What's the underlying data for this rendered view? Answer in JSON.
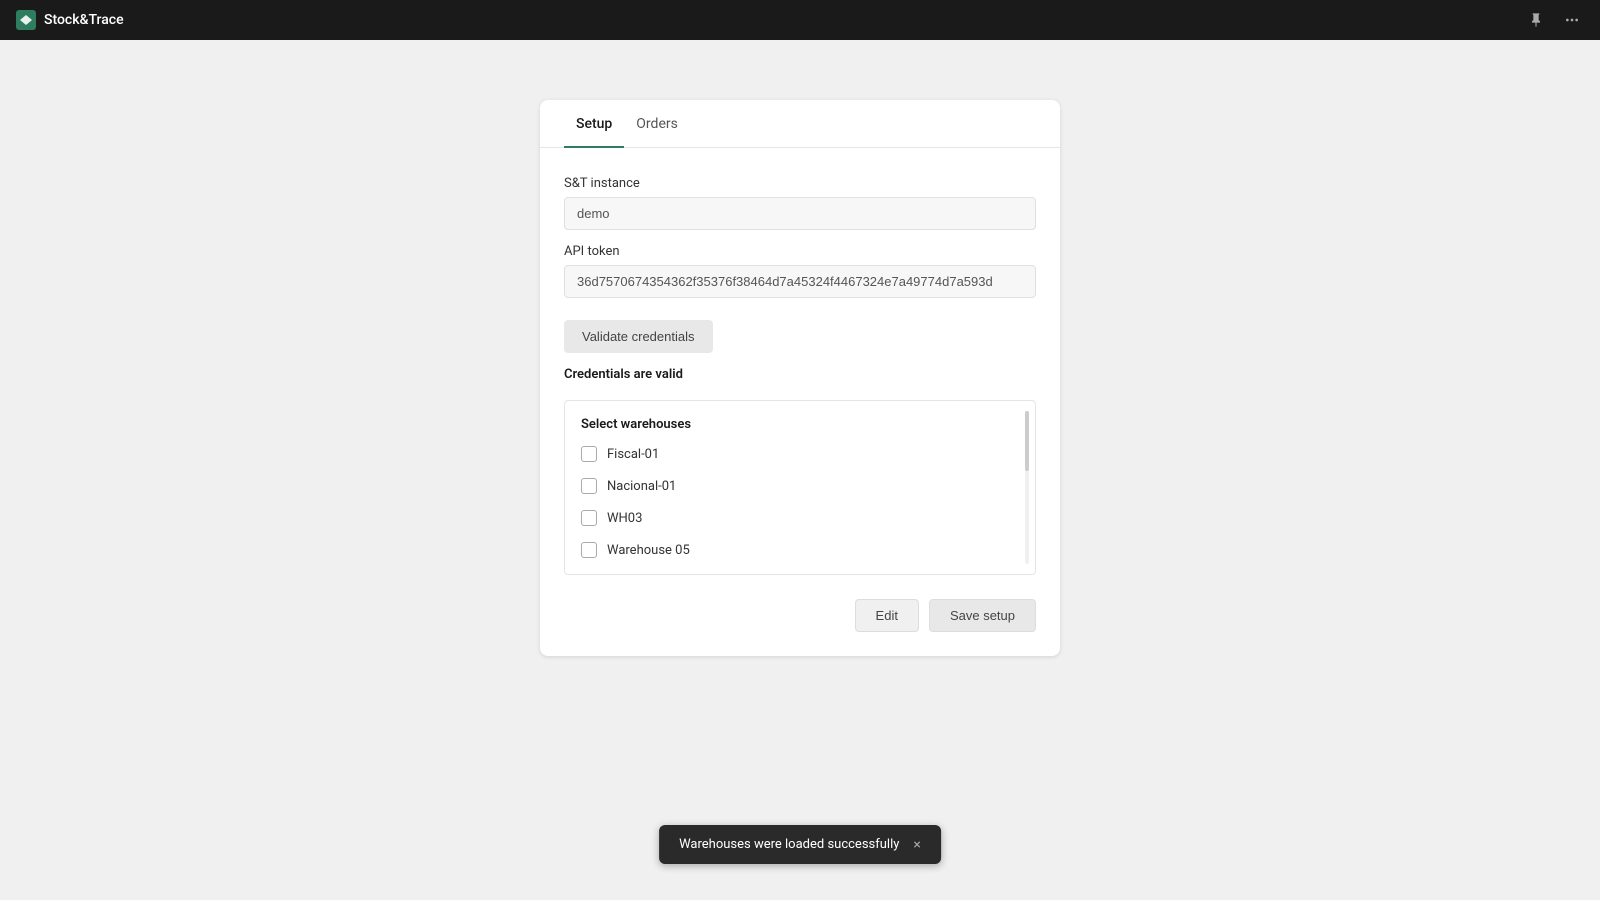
{
  "app": {
    "title": "Stock&Trace"
  },
  "topbar": {
    "pin_icon": "📌",
    "more_icon": "···"
  },
  "tabs": [
    {
      "id": "setup",
      "label": "Setup",
      "active": true
    },
    {
      "id": "orders",
      "label": "Orders",
      "active": false
    }
  ],
  "form": {
    "instance_label": "S&T instance",
    "instance_value": "demo",
    "api_token_label": "API token",
    "api_token_value": "36d7570674354362f35376f38464d7a45324f4467324e7a49774d7a593d",
    "validate_button_label": "Validate credentials",
    "credentials_status": "Credentials are valid",
    "warehouses_title": "Select warehouses",
    "warehouses": [
      {
        "id": "fiscal-01",
        "label": "Fiscal-01",
        "checked": false
      },
      {
        "id": "nacional-01",
        "label": "Nacional-01",
        "checked": false
      },
      {
        "id": "wh03",
        "label": "WH03",
        "checked": false
      },
      {
        "id": "warehouse-05",
        "label": "Warehouse 05",
        "checked": false
      }
    ],
    "edit_button_label": "Edit",
    "save_button_label": "Save setup"
  },
  "toast": {
    "message": "Warehouses were loaded successfully",
    "close_label": "×"
  }
}
